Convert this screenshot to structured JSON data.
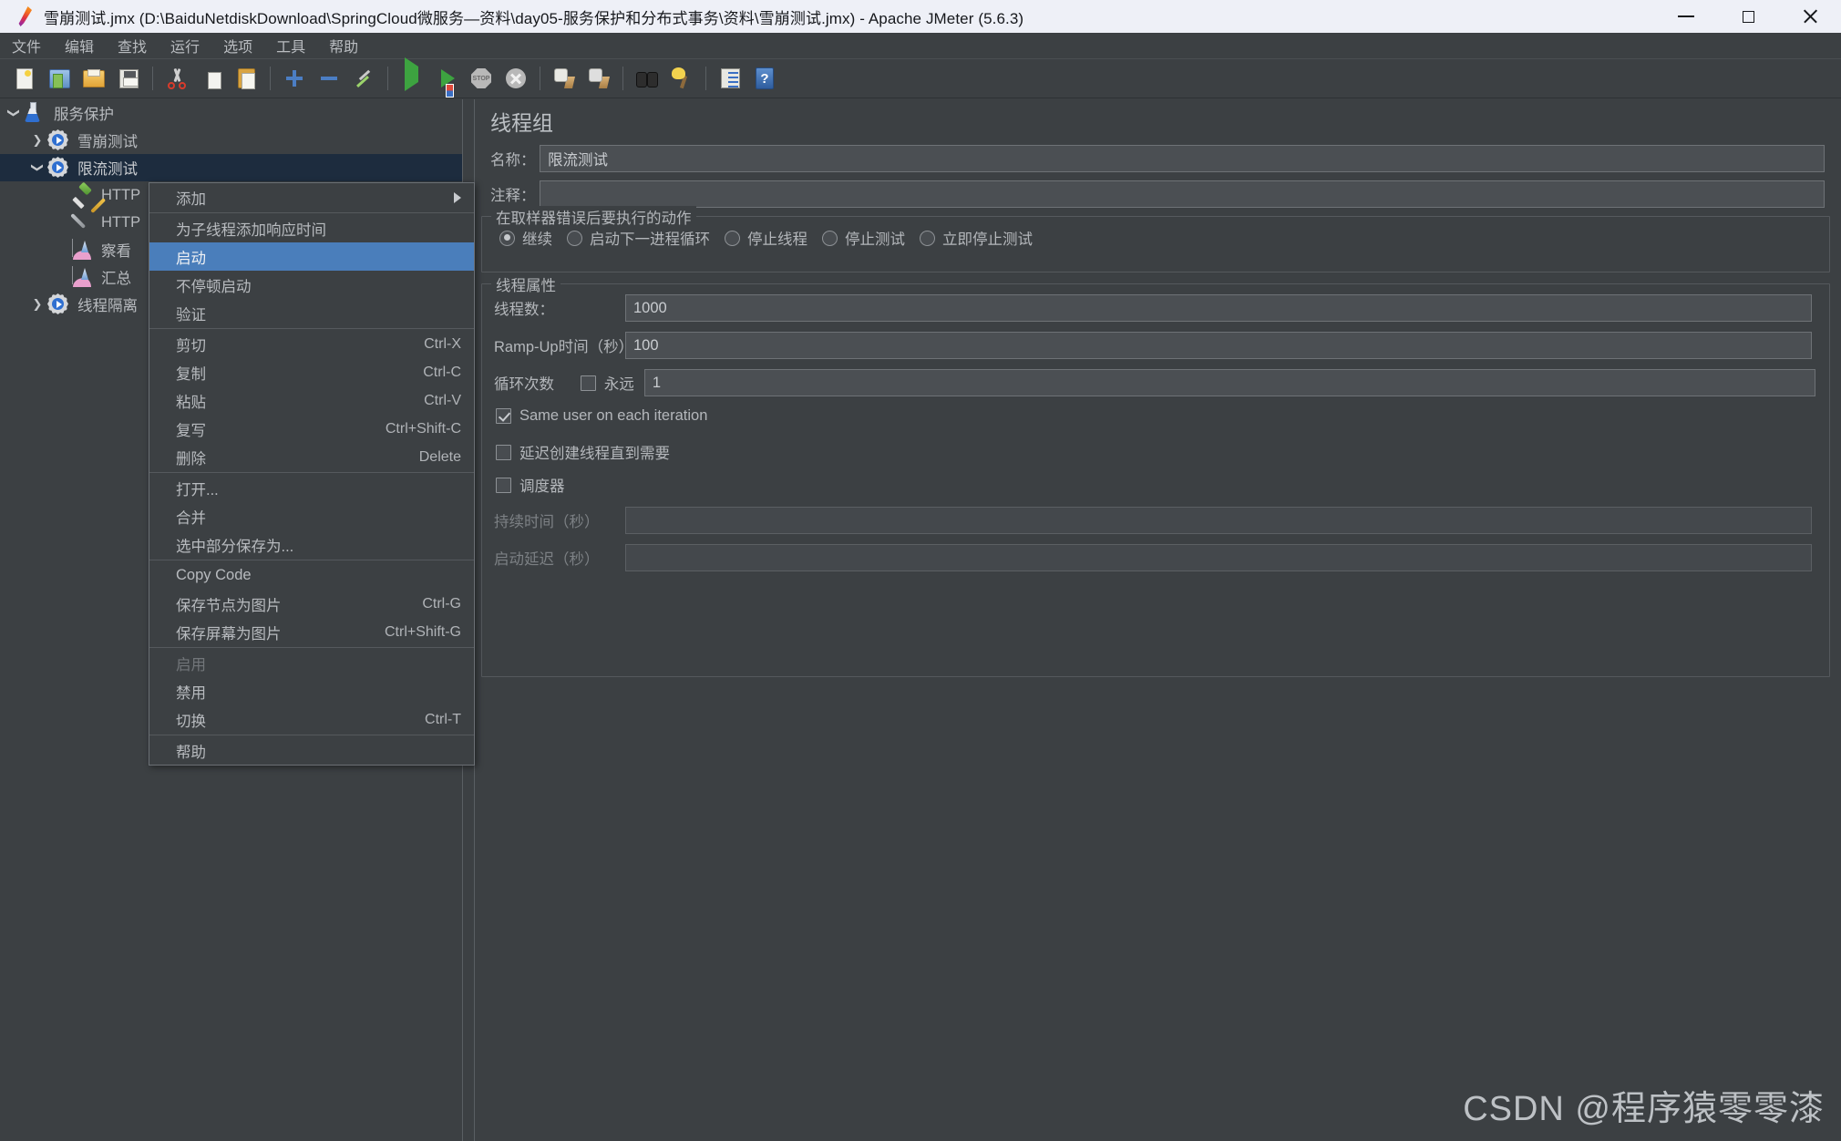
{
  "window": {
    "title": "雪崩测试.jmx (D:\\BaiduNetdiskDownload\\SpringCloud微服务—资料\\day05-服务保护和分布式事务\\资料\\雪崩测试.jmx) - Apache JMeter (5.6.3)",
    "app_icon": "jmeter-feather-icon",
    "minimize_label": "—",
    "maximize_label": "□",
    "close_label": "✕"
  },
  "menubar": {
    "items": [
      {
        "label": "文件",
        "name": "menu-file"
      },
      {
        "label": "编辑",
        "name": "menu-edit"
      },
      {
        "label": "查找",
        "name": "menu-search"
      },
      {
        "label": "运行",
        "name": "menu-run"
      },
      {
        "label": "选项",
        "name": "menu-options"
      },
      {
        "label": "工具",
        "name": "menu-tools"
      },
      {
        "label": "帮助",
        "name": "menu-help"
      }
    ]
  },
  "toolbar": {
    "buttons": [
      {
        "icon": "new-document-icon"
      },
      {
        "icon": "templates-icon"
      },
      {
        "icon": "open-folder-icon"
      },
      {
        "icon": "save-icon"
      },
      {
        "icon": "cut-icon"
      },
      {
        "icon": "copy-icon"
      },
      {
        "icon": "paste-icon"
      },
      {
        "icon": "expand-all-icon"
      },
      {
        "icon": "collapse-all-icon"
      },
      {
        "icon": "toggle-icon"
      },
      {
        "icon": "start-icon"
      },
      {
        "icon": "start-no-pauses-icon"
      },
      {
        "icon": "stop-icon"
      },
      {
        "icon": "shutdown-icon"
      },
      {
        "icon": "clear-icon"
      },
      {
        "icon": "clear-all-icon"
      },
      {
        "icon": "search-icon"
      },
      {
        "icon": "reset-search-icon"
      },
      {
        "icon": "function-helper-icon"
      },
      {
        "icon": "help-icon"
      }
    ]
  },
  "tree": {
    "nodes": [
      {
        "label": "服务保护",
        "icon": "test-plan-flask-icon",
        "depth": 0,
        "expander": "down",
        "selected": false,
        "name": "tree-node-test-plan"
      },
      {
        "label": "雪崩测试",
        "icon": "thread-group-gear-icon",
        "depth": 1,
        "expander": "right",
        "selected": false,
        "name": "tree-node-avalanche-test"
      },
      {
        "label": "限流测试",
        "icon": "thread-group-gear-icon",
        "depth": 1,
        "expander": "down",
        "selected": true,
        "name": "tree-node-ratelimit-test"
      },
      {
        "label": "HTTP",
        "icon": "http-sampler-icon",
        "depth": 2,
        "expander": "none",
        "selected": false,
        "name": "tree-node-http-sampler"
      },
      {
        "label": "HTTP",
        "icon": "http-config-icon",
        "depth": 2,
        "expander": "none",
        "selected": false,
        "name": "tree-node-http-config"
      },
      {
        "label": "察看",
        "icon": "listener-chart-icon",
        "depth": 2,
        "expander": "none",
        "selected": false,
        "name": "tree-node-view-results"
      },
      {
        "label": "汇总",
        "icon": "listener-chart-icon",
        "depth": 2,
        "expander": "none",
        "selected": false,
        "name": "tree-node-summary-report"
      },
      {
        "label": "线程隔离",
        "icon": "thread-group-gear-icon",
        "depth": 1,
        "expander": "right",
        "selected": false,
        "name": "tree-node-thread-isolation"
      }
    ]
  },
  "context_menu": {
    "items": [
      {
        "label": "添加",
        "accel": "",
        "submenu": true,
        "highlight": false,
        "disabled": false,
        "sep_after": true,
        "name": "ctx-add"
      },
      {
        "label": "为子线程添加响应时间",
        "accel": "",
        "submenu": false,
        "highlight": false,
        "disabled": false,
        "sep_after": false,
        "name": "ctx-add-think-times"
      },
      {
        "label": "启动",
        "accel": "",
        "submenu": false,
        "highlight": true,
        "disabled": false,
        "sep_after": false,
        "name": "ctx-start"
      },
      {
        "label": "不停顿启动",
        "accel": "",
        "submenu": false,
        "highlight": false,
        "disabled": false,
        "sep_after": false,
        "name": "ctx-start-no-pauses"
      },
      {
        "label": "验证",
        "accel": "",
        "submenu": false,
        "highlight": false,
        "disabled": false,
        "sep_after": true,
        "name": "ctx-validate"
      },
      {
        "label": "剪切",
        "accel": "Ctrl-X",
        "submenu": false,
        "highlight": false,
        "disabled": false,
        "sep_after": false,
        "name": "ctx-cut"
      },
      {
        "label": "复制",
        "accel": "Ctrl-C",
        "submenu": false,
        "highlight": false,
        "disabled": false,
        "sep_after": false,
        "name": "ctx-copy"
      },
      {
        "label": "粘贴",
        "accel": "Ctrl-V",
        "submenu": false,
        "highlight": false,
        "disabled": false,
        "sep_after": false,
        "name": "ctx-paste"
      },
      {
        "label": "复写",
        "accel": "Ctrl+Shift-C",
        "submenu": false,
        "highlight": false,
        "disabled": false,
        "sep_after": false,
        "name": "ctx-duplicate"
      },
      {
        "label": "删除",
        "accel": "Delete",
        "submenu": false,
        "highlight": false,
        "disabled": false,
        "sep_after": true,
        "name": "ctx-remove"
      },
      {
        "label": "打开...",
        "accel": "",
        "submenu": false,
        "highlight": false,
        "disabled": false,
        "sep_after": false,
        "name": "ctx-open"
      },
      {
        "label": "合并",
        "accel": "",
        "submenu": false,
        "highlight": false,
        "disabled": false,
        "sep_after": false,
        "name": "ctx-merge"
      },
      {
        "label": "选中部分保存为...",
        "accel": "",
        "submenu": false,
        "highlight": false,
        "disabled": false,
        "sep_after": true,
        "name": "ctx-save-selection-as"
      },
      {
        "label": "Copy Code",
        "accel": "",
        "submenu": false,
        "highlight": false,
        "disabled": false,
        "sep_after": false,
        "name": "ctx-copy-code"
      },
      {
        "label": "保存节点为图片",
        "accel": "Ctrl-G",
        "submenu": false,
        "highlight": false,
        "disabled": false,
        "sep_after": false,
        "name": "ctx-save-node-as-image"
      },
      {
        "label": "保存屏幕为图片",
        "accel": "Ctrl+Shift-G",
        "submenu": false,
        "highlight": false,
        "disabled": false,
        "sep_after": true,
        "name": "ctx-save-screen-as-image"
      },
      {
        "label": "启用",
        "accel": "",
        "submenu": false,
        "highlight": false,
        "disabled": true,
        "sep_after": false,
        "name": "ctx-enable"
      },
      {
        "label": "禁用",
        "accel": "",
        "submenu": false,
        "highlight": false,
        "disabled": false,
        "sep_after": false,
        "name": "ctx-disable"
      },
      {
        "label": "切换",
        "accel": "Ctrl-T",
        "submenu": false,
        "highlight": false,
        "disabled": false,
        "sep_after": true,
        "name": "ctx-toggle"
      },
      {
        "label": "帮助",
        "accel": "",
        "submenu": false,
        "highlight": false,
        "disabled": false,
        "sep_after": false,
        "name": "ctx-help"
      }
    ]
  },
  "thread_group": {
    "title": "线程组",
    "name_label": "名称：",
    "name_value": "限流测试",
    "comment_label": "注释：",
    "comment_value": "",
    "on_error": {
      "legend": "在取样器错误后要执行的动作",
      "options": [
        {
          "label": "继续",
          "checked": true,
          "name": "radio-continue"
        },
        {
          "label": "启动下一进程循环",
          "checked": false,
          "name": "radio-start-next-loop"
        },
        {
          "label": "停止线程",
          "checked": false,
          "name": "radio-stop-thread"
        },
        {
          "label": "停止测试",
          "checked": false,
          "name": "radio-stop-test"
        },
        {
          "label": "立即停止测试",
          "checked": false,
          "name": "radio-stop-test-now"
        }
      ]
    },
    "properties": {
      "legend": "线程属性",
      "threads_label": "线程数：",
      "threads_value": "1000",
      "rampup_label": "Ramp-Up时间（秒）：",
      "rampup_value": "100",
      "loops_label": "循环次数",
      "forever_label": "永远",
      "forever_checked": false,
      "loops_value": "1",
      "same_user_label": "Same user on each iteration",
      "same_user_checked": true,
      "delay_create_label": "延迟创建线程直到需要",
      "delay_create_checked": false,
      "scheduler_label": "调度器",
      "scheduler_checked": false,
      "duration_label": "持续时间（秒）",
      "duration_value": "",
      "startup_delay_label": "启动延迟（秒）",
      "startup_delay_value": ""
    }
  },
  "watermark": {
    "text": "CSDN @程序猿零零漆"
  }
}
